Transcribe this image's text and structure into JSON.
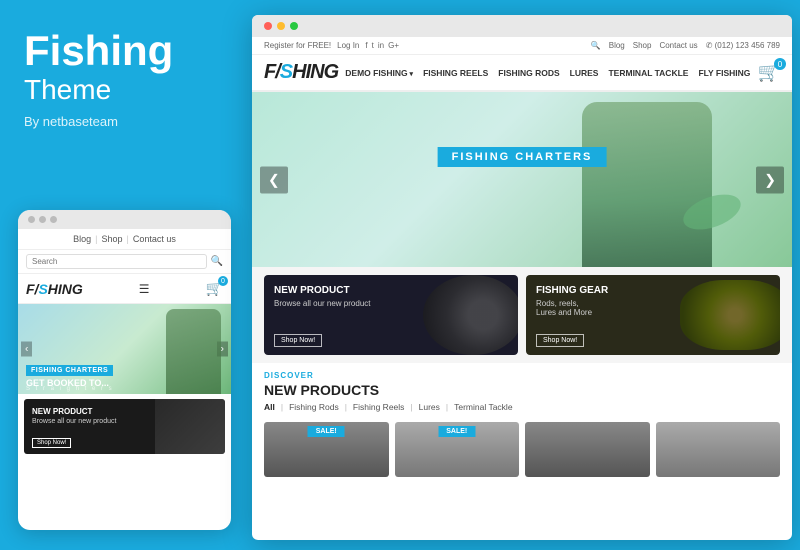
{
  "left": {
    "title": "Fishing",
    "subtitle": "Theme",
    "byline": "By netbaseteam"
  },
  "mobile": {
    "nav_blog": "Blog",
    "nav_shop": "Shop",
    "nav_contact": "Contact us",
    "search_placeholder": "Search",
    "logo": "F/SHING",
    "cart_badge": "0",
    "hero_label": "FISHING CHARTERS",
    "hero_cta": "GET BOOKED TO...",
    "hero_small": "S t r a i g h t e r s",
    "product_title": "NEW PRODUCT",
    "product_desc": "Browse all our new product",
    "product_btn": "Shop Now!"
  },
  "browser": {
    "titlebar_dots": [
      "red",
      "yellow",
      "green"
    ],
    "header_top": {
      "register": "Register for FREE!",
      "login": "Log In",
      "blog": "Blog",
      "shop": "Shop",
      "contact": "Contact us",
      "phone": "✆ (012) 123 456 789"
    },
    "nav": {
      "logo": "F/SHING",
      "items": [
        {
          "label": "DEMO FISHING",
          "arrow": true
        },
        {
          "label": "FISHING REELS",
          "arrow": false
        },
        {
          "label": "FISHING RODS",
          "arrow": false
        },
        {
          "label": "LURES",
          "arrow": false
        },
        {
          "label": "TERMINAL TACKLE",
          "arrow": false
        },
        {
          "label": "FLY FISHING",
          "arrow": false
        }
      ],
      "cart_badge": "0"
    },
    "hero": {
      "label": "FISHING CHARTERS"
    },
    "banners": [
      {
        "title": "NEW PRODUCT",
        "desc": "Browse all our new product",
        "btn": "Shop Now!",
        "type": "reel"
      },
      {
        "title": "FISHING GEAR",
        "desc": "Rods, reels,\nLures and More",
        "btn": "Shop Now!",
        "type": "reel2"
      }
    ],
    "discover": {
      "label": "DISCOVER",
      "title": "NEW PRODUCTS",
      "filters": [
        {
          "label": "All",
          "active": true
        },
        {
          "label": "Fishing Rods"
        },
        {
          "label": "Fishing Reels"
        },
        {
          "label": "Lures"
        },
        {
          "label": "Terminal Tackle"
        }
      ]
    },
    "product_cards": [
      {
        "badge": "SALE!"
      },
      {
        "badge": "SALE!"
      }
    ]
  }
}
